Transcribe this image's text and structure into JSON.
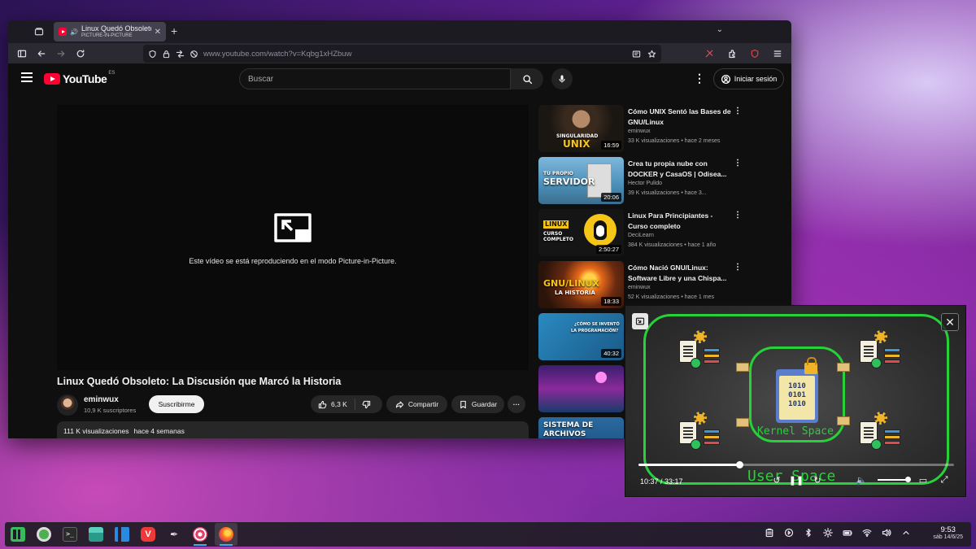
{
  "browser": {
    "tab": {
      "title": "Linux Quedó Obsoleto",
      "subtitle": "PICTURE-IN-PICTURE"
    },
    "url": {
      "domain": "www.youtube.com",
      "path": "/watch?v=Kqbg1xHZbuw"
    }
  },
  "youtube": {
    "logo_text": "YouTube",
    "region": "ES",
    "search_placeholder": "Buscar",
    "signin_label": "Iniciar sesión",
    "player_message": "Este vídeo se está reproduciendo en el modo Picture-in-Picture.",
    "video": {
      "title": "Linux Quedó Obsoleto: La Discusión que Marcó la Historia",
      "channel": "eminwux",
      "subscribers": "10,9 K suscriptores",
      "subscribe_label": "Suscribirme",
      "likes": "6,3 K",
      "share_label": "Compartir",
      "save_label": "Guardar",
      "views": "111 K visualizaciones",
      "date": "hace 4 semanas"
    },
    "recommendations": [
      {
        "title": "Cómo UNIX Sentó las Bases de GNU/Linux",
        "channel": "eminwux",
        "views": "33 K visualizaciones",
        "age": "hace 2 meses",
        "duration": "16:59",
        "thumb_text": "SINGULARIDAD UNIX",
        "thumb_color": "#2b2622"
      },
      {
        "title": "Crea tu propia nube con DOCKER y CasaOS | Odisea...",
        "channel": "Hector Pulido",
        "views": "39 K visualizaciones",
        "age": "hace 3...",
        "duration": "20:06",
        "thumb_text": "TU PROPIO SERVIDOR",
        "thumb_color": "#4a8fb8"
      },
      {
        "title": "Linux Para Principiantes - Curso completo",
        "channel": "DeciLearn",
        "views": "384 K visualizaciones",
        "age": "hace 1 año",
        "duration": "2:50:27",
        "thumb_text": "LINUX CURSO COMPLETO",
        "thumb_color": "#1a1a1a"
      },
      {
        "title": "Cómo Nació GNU/Linux: Software Libre y una Chispa...",
        "channel": "eminwux",
        "views": "52 K visualizaciones",
        "age": "hace 1 mes",
        "duration": "18:33",
        "thumb_text": "GNU/LINUX LA HISTORIA",
        "thumb_color": "#7a3a14"
      },
      {
        "title": "",
        "channel": "",
        "views": "",
        "age": "",
        "duration": "40:32",
        "thumb_text": "¿CÓMO SE INVENTÓ LA PROGRAMACIÓN?",
        "thumb_color": "#1d6fa0"
      },
      {
        "title": "",
        "channel": "",
        "views": "",
        "age": "",
        "duration": "",
        "thumb_text": "",
        "thumb_color": "#3a1e6e"
      },
      {
        "title": "",
        "channel": "",
        "views": "",
        "age": "",
        "duration": "",
        "thumb_text": "SISTEMA DE ARCHIVOS",
        "thumb_color": "#1e5a8a"
      }
    ]
  },
  "pip": {
    "kernel_label": "Kernel Space",
    "user_label": "User Space",
    "binary": [
      "1010",
      "0101",
      "1010"
    ],
    "time": "10:37 / 33:17",
    "progress_fraction": 0.32,
    "accent": "#27d13a"
  },
  "taskbar": {
    "apps": [
      "manjaro-menu-icon",
      "downloads-icon",
      "terminal-icon",
      "file-manager-icon",
      "vscode-icon",
      "vivaldi-icon",
      "inkscape-icon",
      "screenshot-tool-icon",
      "firefox-icon"
    ],
    "time": "9:53",
    "date": "sáb 14/6/25"
  }
}
